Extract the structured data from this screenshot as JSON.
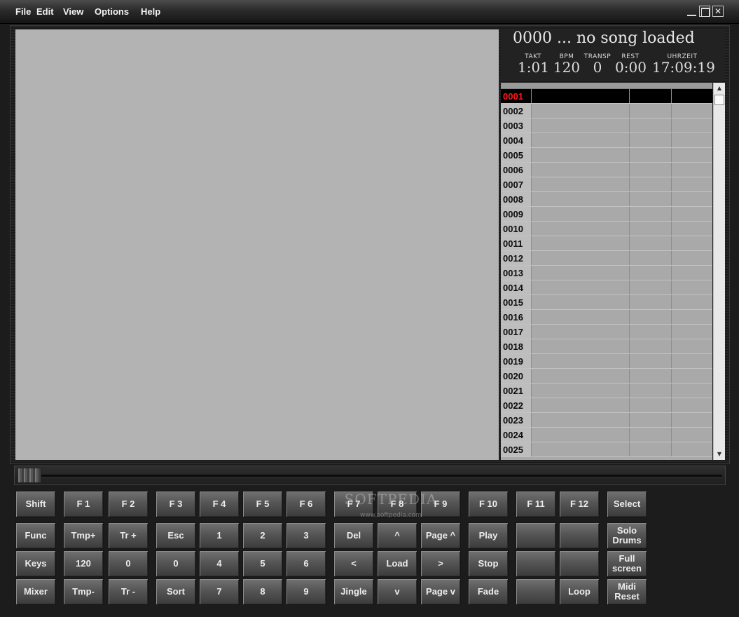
{
  "menu": [
    "File",
    "Edit",
    "View",
    "Options",
    "Help"
  ],
  "window_controls": {
    "minimize": "_",
    "maximize": "□",
    "close": "✕"
  },
  "info": {
    "song_title": "0000 ... no song loaded",
    "stats": [
      {
        "label": "TAKT",
        "value": "1:01"
      },
      {
        "label": "BPM",
        "value": "120"
      },
      {
        "label": "TRANSP",
        "value": "0"
      },
      {
        "label": "REST",
        "value": "0:00"
      },
      {
        "label": "UHRZEIT",
        "value": "17:09:19"
      }
    ]
  },
  "playlist": {
    "selected": "0001",
    "rows": [
      "0001",
      "0002",
      "0003",
      "0004",
      "0005",
      "0006",
      "0007",
      "0008",
      "0009",
      "0010",
      "0011",
      "0012",
      "0013",
      "0014",
      "0015",
      "0016",
      "0017",
      "0018",
      "0019",
      "0020",
      "0021",
      "0022",
      "0023",
      "0024",
      "0025"
    ]
  },
  "watermark": {
    "brand": "SOFTPEDIA",
    "url": "www.softpedia.com"
  },
  "keypad": {
    "rows": [
      [
        "Shift",
        "F 1",
        "F 2",
        "F 3",
        "F 4",
        "F 5",
        "F 6",
        "F 7",
        "F 8",
        "F 9",
        "F 10",
        "F 11",
        "F 12",
        "Select"
      ],
      [
        "Func",
        "Tmp+",
        "Tr +",
        "Esc",
        "1",
        "2",
        "3",
        "Del",
        "^",
        "Page ^",
        "Play",
        "",
        "",
        "Solo Drums"
      ],
      [
        "Keys",
        "120",
        "0",
        "0",
        "4",
        "5",
        "6",
        "<",
        "Load",
        ">",
        "Stop",
        "",
        "",
        "Full screen"
      ],
      [
        "Mixer",
        "Tmp-",
        "Tr -",
        "Sort",
        "7",
        "8",
        "9",
        "Jingle",
        "v",
        "Page v",
        "Fade",
        "",
        "Loop",
        "Midi Reset"
      ]
    ]
  },
  "colors": {
    "selected_row_text": "#ff1a1a",
    "canvas_bg": "#b3b3b3"
  }
}
